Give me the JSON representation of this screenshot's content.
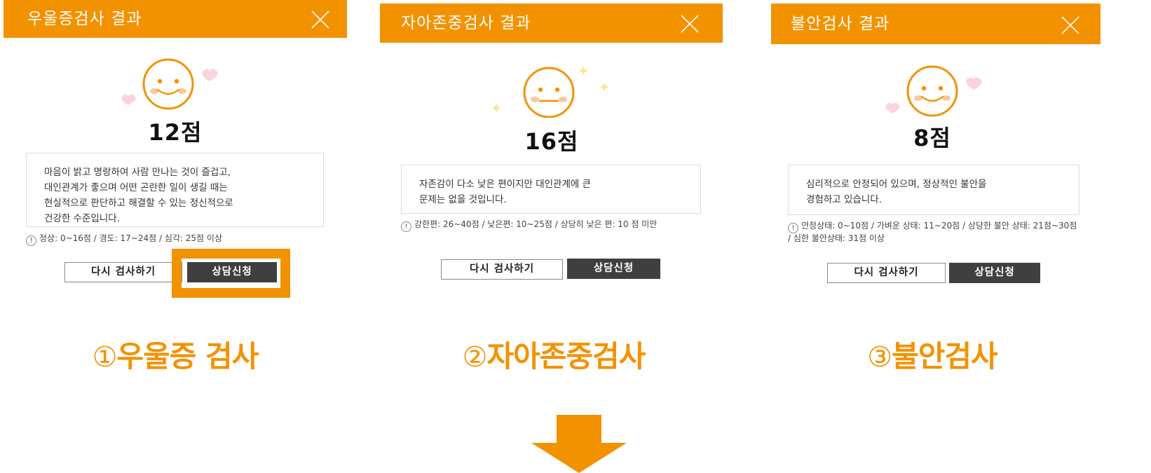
{
  "accent_color": "#f39200",
  "button_dark_color": "#3f3f3f",
  "panels": [
    {
      "title": "우울증검사 결과",
      "score": "12점",
      "face": "smile",
      "description": [
        "마음이 밝고 명랑하여 사람 만나는 것이 즐겁고,",
        "대인관계가 좋으며 어떤 곤란한 일이 생길 때는",
        "현실적으로 판단하고 해결할 수 있는 정신적으로",
        "건강한 수준입니다."
      ],
      "legend": "정상: 0~16점 / 경도: 17~24점 / 심각: 25점 이상",
      "retry_label": "다시 검사하기",
      "consult_label": "상담신청",
      "highlighted": true,
      "caption_num": "①",
      "caption_text": "우울증 검사"
    },
    {
      "title": "자아존중검사 결과",
      "score": "16점",
      "face": "neutral",
      "description": [
        "자존감이 다소 낮은 편이지만 대인관계에 큰",
        "문제는 없을 것입니다."
      ],
      "legend": "강한편: 26~40점 / 낮은편: 10~25점 / 상당히 낮은 편: 10 점 미만",
      "retry_label": "다시 검사하기",
      "consult_label": "상담신청",
      "highlighted": false,
      "caption_num": "②",
      "caption_text": "자아존중검사"
    },
    {
      "title": "불안검사 결과",
      "score": "8점",
      "face": "smile",
      "description": [
        "심리적으로 안정되어 있으며, 정상적인 불안을",
        "경험하고 있습니다."
      ],
      "legend": "안정상태: 0~10점 / 가벼운 상태: 11~20점 / 상당한 불안 상태: 21점~30점 / 심한 불안상태: 31점 이상",
      "retry_label": "다시 검사하기",
      "consult_label": "상담신청",
      "highlighted": false,
      "caption_num": "③",
      "caption_text": "불안검사"
    }
  ],
  "info_icon_glyph": "!"
}
